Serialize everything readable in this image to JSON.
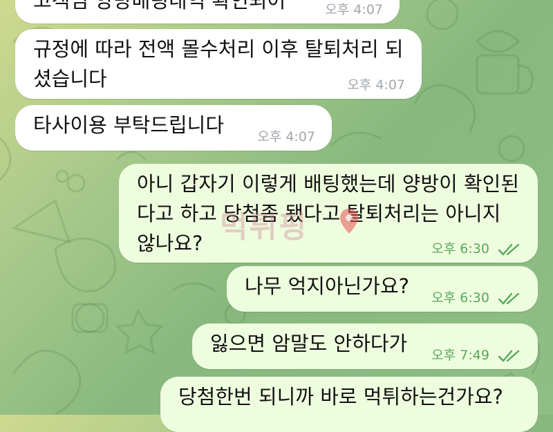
{
  "messages": [
    {
      "direction": "in",
      "text": "고객님 양방배팅내역 확인되어",
      "time": "오후 4:07"
    },
    {
      "direction": "in",
      "text": "규정에 따라 전액 몰수처리 이후 탈퇴처리 되셨습니다",
      "time": "오후 4:07"
    },
    {
      "direction": "in",
      "text": "타사이용 부탁드립니다",
      "time": "오후 4:07"
    },
    {
      "direction": "out",
      "text": "아니 갑자기 이렇게 배팅했는데 양방이 확인된다고 하고 당첨좀 됐다고 탈퇴처리는 아니지 않나요?",
      "time": "오후 6:30",
      "status": "read"
    },
    {
      "direction": "out",
      "text": "나무 억지아닌가요?",
      "time": "오후 6:30",
      "status": "read"
    },
    {
      "direction": "out",
      "text": "잃으면 암말도 안하다가",
      "time": "오후 7:49",
      "status": "read"
    },
    {
      "direction": "out",
      "text": "당첨한번 되니까 바로 먹튀하는건가요?",
      "time": "",
      "status": ""
    }
  ],
  "watermark": {
    "text": "먹튀핑"
  },
  "icons": {
    "read_receipt": "double-check-icon"
  }
}
